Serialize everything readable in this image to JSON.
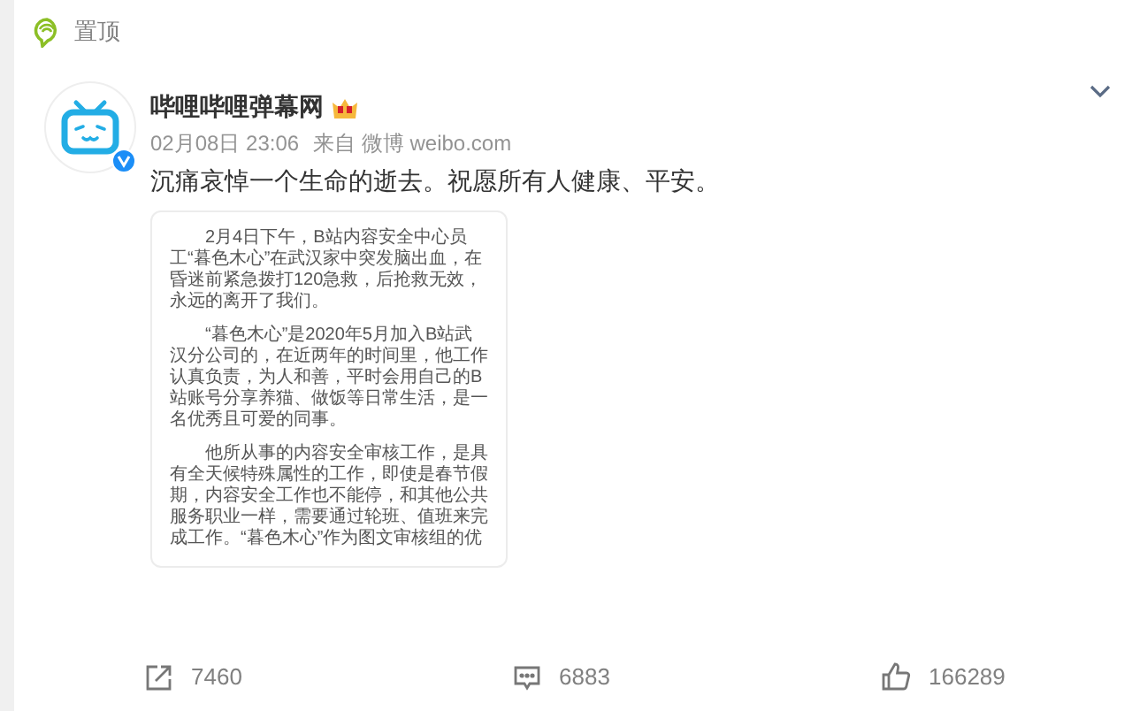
{
  "pinned": {
    "label": "置顶"
  },
  "post": {
    "author": "哔哩哔哩弹幕网",
    "time": "02月08日 23:06",
    "source": "来自 微博 weibo.com",
    "text": "沉痛哀悼一个生命的逝去。祝愿所有人健康、平安。",
    "image": {
      "paragraphs": [
        "2月4日下午，B站内容安全中心员工“暮色木心”在武汉家中突发脑出血，在昏迷前紧急拨打120急救，后抢救无效，永远的离开了我们。",
        "“暮色木心”是2020年5月加入B站武汉分公司的，在近两年的时间里，他工作认真负责，为人和善，平时会用自己的B站账号分享养猫、做饭等日常生活，是一名优秀且可爱的同事。",
        "他所从事的内容安全审核工作，是具有全天候特殊属性的工作，即使是春节假期，内容安全工作也不能停，和其他公共服务职业一样，需要通过轮班、值班来完成工作。“暮色木心”作为图文审核组的优"
      ]
    },
    "actions": [
      {
        "kind": "share",
        "count": "7460"
      },
      {
        "kind": "comment",
        "count": "6883"
      },
      {
        "kind": "like",
        "count": "166289"
      }
    ]
  }
}
